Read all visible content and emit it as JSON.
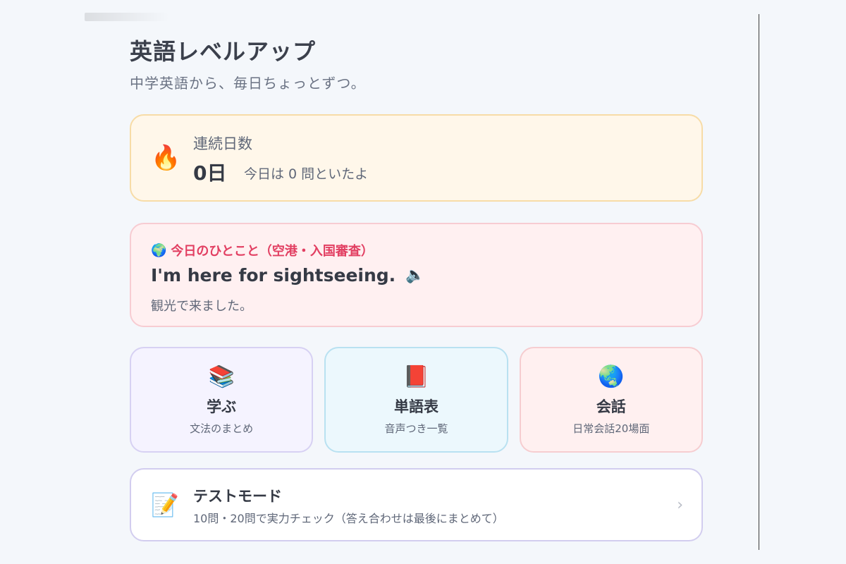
{
  "header": {
    "title": "英語レベルアップ",
    "subtitle": "中学英語から、毎日ちょっとずつ。"
  },
  "streak": {
    "icon": "🔥",
    "label": "連続日数",
    "days": "0日",
    "today": "今日は 0 問といたよ"
  },
  "phrase": {
    "icon": "🌍",
    "label": "今日のひとこと（空港・入国審査）",
    "english": "I'm here for sightseeing.",
    "speaker_icon": "🔈",
    "japanese": "観光で来ました。"
  },
  "tiles": [
    {
      "icon": "📚",
      "title": "学ぶ",
      "subtitle": "文法のまとめ"
    },
    {
      "icon": "📕",
      "title": "単語表",
      "subtitle": "音声つき一覧"
    },
    {
      "icon": "🌏",
      "title": "会話",
      "subtitle": "日常会話20場面"
    }
  ],
  "test_mode": {
    "icon": "📝",
    "title": "テストモード",
    "subtitle": "10問・20問で実力チェック（答え合わせは最後にまとめて）",
    "chevron": "›"
  }
}
